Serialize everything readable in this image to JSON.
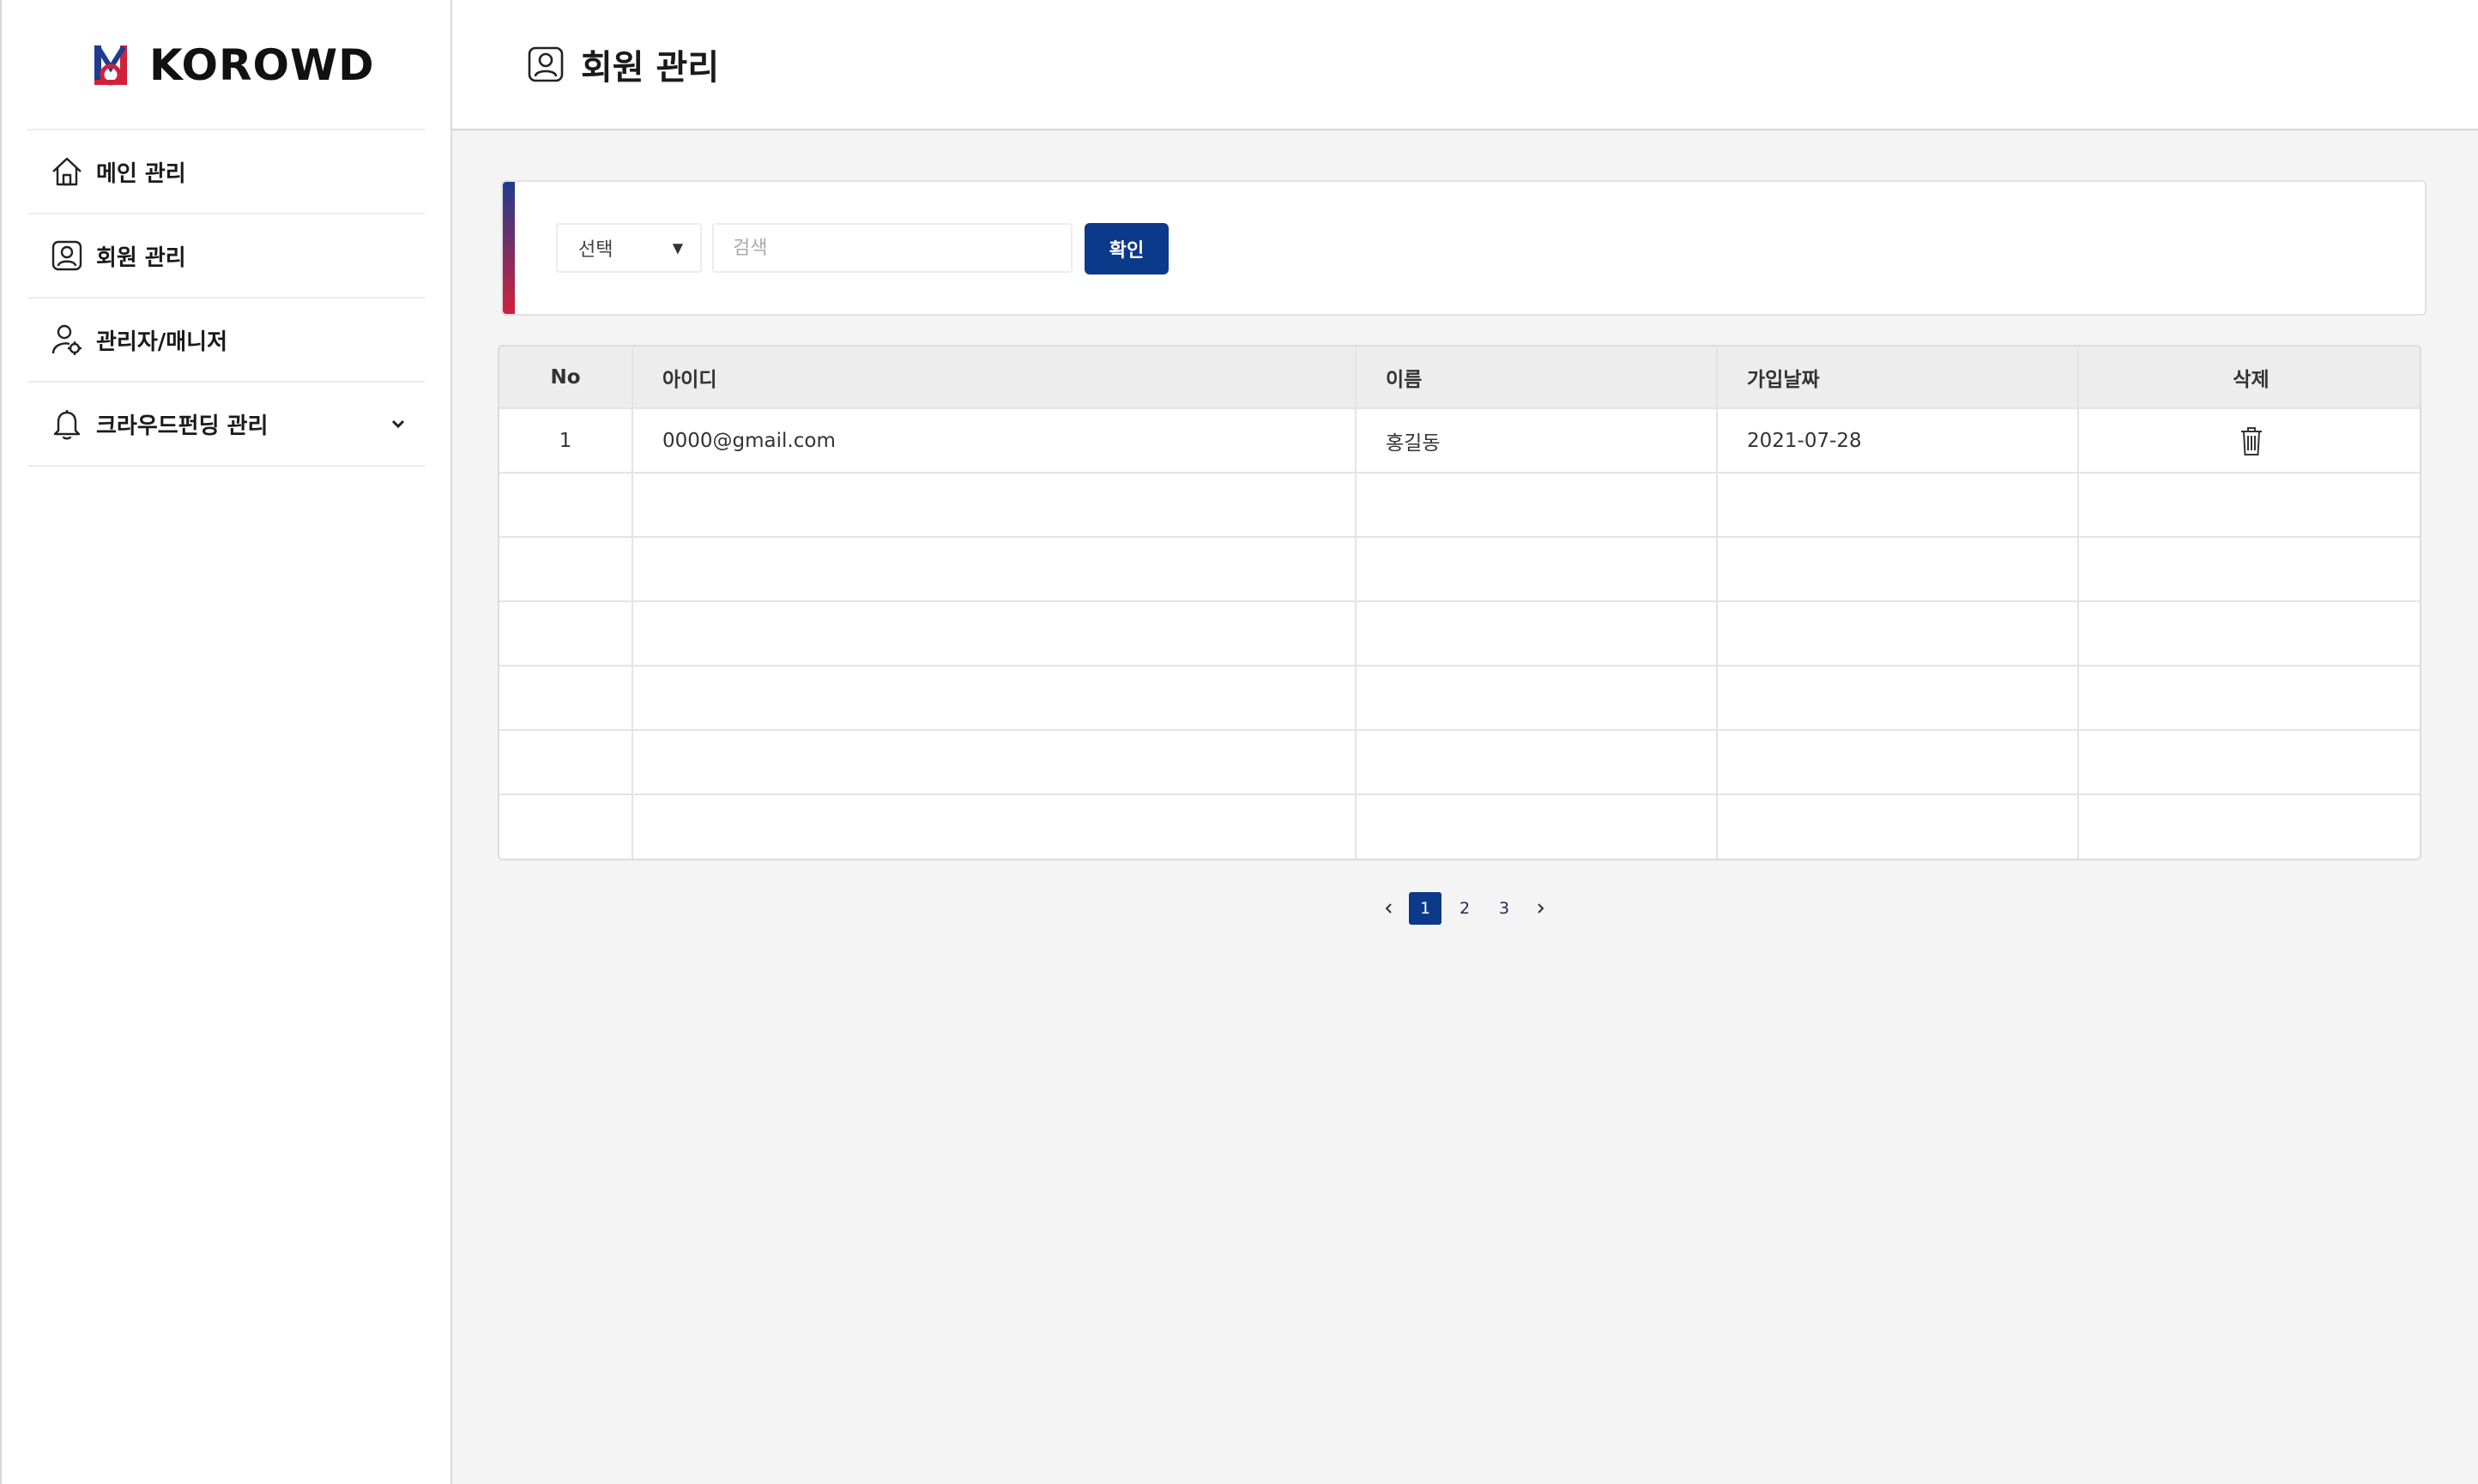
{
  "brand": {
    "name": "KOROWD"
  },
  "sidebar": {
    "items": [
      {
        "label": "메인 관리",
        "icon": "home-icon"
      },
      {
        "label": "회원 관리",
        "icon": "user-card-icon"
      },
      {
        "label": "관리자/매니저",
        "icon": "user-gear-icon"
      },
      {
        "label": "크라우드펀딩 관리",
        "icon": "bell-icon",
        "expandable": true
      }
    ]
  },
  "header": {
    "title": "회원 관리",
    "icon": "user-card-icon"
  },
  "search": {
    "select_value": "선택",
    "input_value": "",
    "placeholder": "검색",
    "confirm_label": "확인"
  },
  "table": {
    "columns": [
      "No",
      "아이디",
      "이름",
      "가입날짜",
      "삭제"
    ],
    "rows": [
      {
        "no": "1",
        "id": "0000@gmail.com",
        "name": "홍길동",
        "date": "2021-07-28",
        "delete_icon": "trash-icon"
      }
    ],
    "empty_rows": 6
  },
  "pagination": {
    "pages": [
      "1",
      "2",
      "3"
    ],
    "current": "1"
  },
  "colors": {
    "primary": "#0b3a8a",
    "accent_top": "#1f3c8f",
    "accent_bottom": "#d0213a",
    "background": "#f4f4f4"
  }
}
